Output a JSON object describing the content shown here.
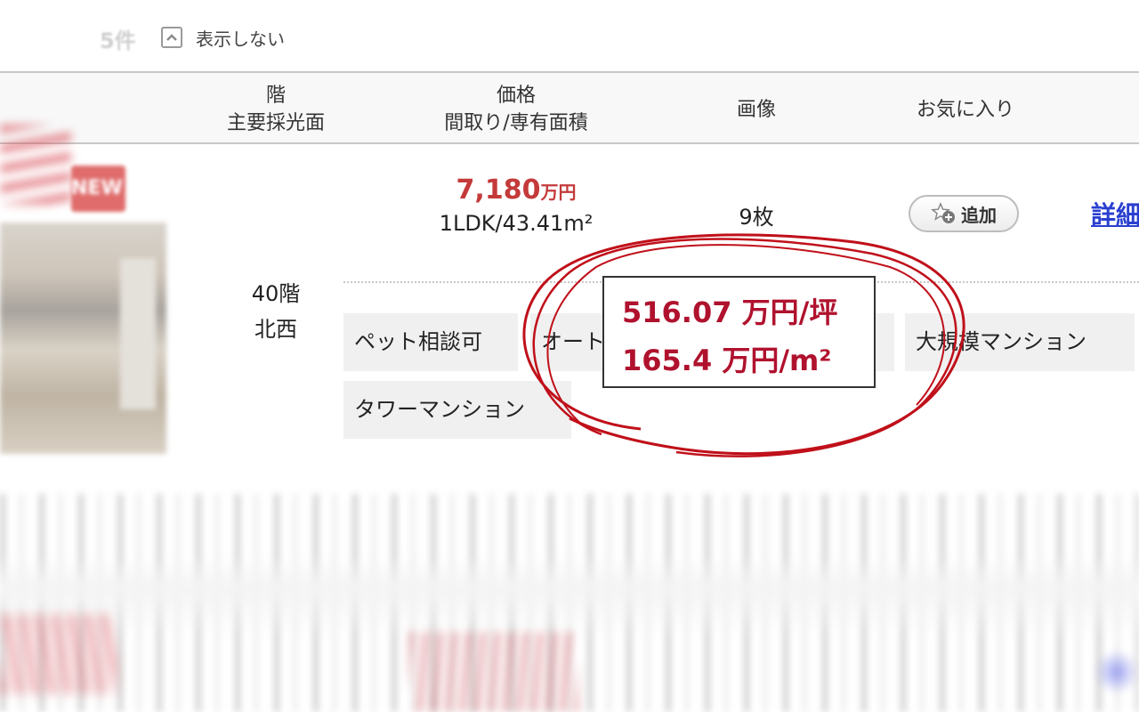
{
  "toolbar": {
    "result_count": "5件",
    "hide_label": "表示しない"
  },
  "columns": {
    "floor_line1": "階",
    "floor_line2": "主要採光面",
    "price_line1": "価格",
    "price_line2": "間取り/専有面積",
    "images": "画像",
    "favorite": "お気に入り"
  },
  "listing": {
    "badge": "NEW",
    "floor": "40階",
    "direction": "北西",
    "price_amount": "7,180",
    "price_unit": "万円",
    "layout_area": "1LDK/43.41m²",
    "image_count": "9枚",
    "add_favorite": "追加",
    "detail_link": "詳細",
    "tags": [
      "ペット相談可",
      "オートロック",
      "ー",
      "大規模マンション",
      "タワーマンション"
    ]
  },
  "callout": {
    "per_tsubo": "516.07 万円/坪",
    "per_sqm": "165.4 万円/m²"
  },
  "colors": {
    "price_red": "#c43a3a",
    "callout_red": "#b0122e",
    "annotation_red": "#c0101a",
    "link_blue": "#2a3fd0"
  }
}
